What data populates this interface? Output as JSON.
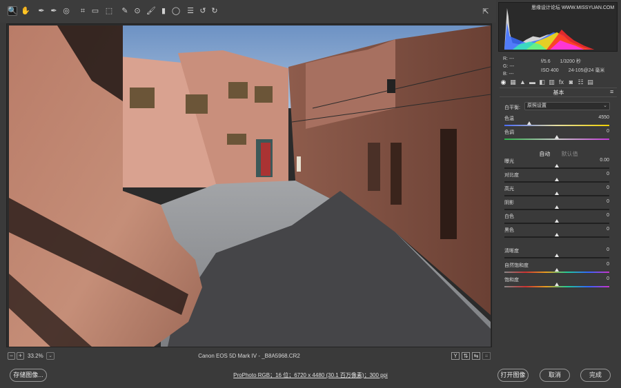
{
  "toolbar": {
    "tools": [
      {
        "name": "zoom-tool",
        "glyph": "🔍",
        "active": true
      },
      {
        "name": "hand-tool",
        "glyph": "✋"
      },
      {
        "name": "white-balance-tool",
        "glyph": "✒"
      },
      {
        "name": "color-sampler-tool",
        "glyph": "✒"
      },
      {
        "name": "targeted-adjustment-tool",
        "glyph": "◎"
      },
      {
        "name": "crop-tool",
        "glyph": "⌗"
      },
      {
        "name": "straighten-tool",
        "glyph": "▭"
      },
      {
        "name": "transform-tool",
        "glyph": "⬚"
      },
      {
        "name": "spot-removal-tool",
        "glyph": "✎"
      },
      {
        "name": "red-eye-tool",
        "glyph": "⊙"
      },
      {
        "name": "adjustment-brush-tool",
        "glyph": "🖌"
      },
      {
        "name": "graduated-filter-tool",
        "glyph": "▮"
      },
      {
        "name": "radial-filter-tool",
        "glyph": "◯"
      },
      {
        "name": "preferences-tool",
        "glyph": "☰"
      },
      {
        "name": "rotate-ccw-tool",
        "glyph": "↺"
      },
      {
        "name": "rotate-cw-tool",
        "glyph": "↻"
      }
    ],
    "fullscreen_glyph": "⇱"
  },
  "watermark": "思缘设计论坛 WWW.MISSYUAN.COM",
  "statusbar": {
    "zoom_out": "−",
    "zoom_in": "+",
    "zoom_level": "33.2%",
    "zoom_dropdown": "⌄",
    "file_info": "Canon EOS 5D Mark IV -  _B8A5968.CR2",
    "view_buttons": [
      "Y",
      "⇅",
      "⇆"
    ]
  },
  "bottom": {
    "save_label": "存储图像...",
    "workflow": "ProPhoto RGB；16 位；6720 x 4480 (30.1 百万像素)；300 ppi",
    "open_label": "打开图像",
    "cancel_label": "取消",
    "done_label": "完成"
  },
  "panel": {
    "rgb": {
      "r": "R:   ---",
      "g": "G:   ---",
      "b": "B:   ---"
    },
    "camera": {
      "aperture": "f/5.6",
      "shutter": "1/3200 秒",
      "iso": "ISO 400",
      "lens": "24-105@24 毫米"
    },
    "tabs": [
      "◉",
      "▦",
      "▲",
      "▬",
      "◧",
      "▥",
      "fx",
      "◙",
      "☷",
      "▤"
    ],
    "section_title": "基本",
    "section_menu": "≡",
    "wb_label": "白平衡:",
    "wb_value": "原照设置",
    "auto_label": "自动",
    "default_label": "默认值",
    "sliders": [
      {
        "key": "temperature",
        "label": "色温",
        "value": "4550",
        "pos": 0.24,
        "gradient": "linear-gradient(to right,#4a6cff,#e8e0a0,#f0d000)"
      },
      {
        "key": "tint",
        "label": "色调",
        "value": "0",
        "pos": 0.5,
        "gradient": "linear-gradient(to right,#2fb34a,#cccccc,#c43ad8)"
      },
      {
        "key": "exposure",
        "label": "曝光",
        "value": "0.00",
        "pos": 0.5
      },
      {
        "key": "contrast",
        "label": "对比度",
        "value": "0",
        "pos": 0.5
      },
      {
        "key": "highlights",
        "label": "高光",
        "value": "0",
        "pos": 0.5
      },
      {
        "key": "shadows",
        "label": "阴影",
        "value": "0",
        "pos": 0.5
      },
      {
        "key": "whites",
        "label": "白色",
        "value": "0",
        "pos": 0.5
      },
      {
        "key": "blacks",
        "label": "黑色",
        "value": "0",
        "pos": 0.5
      },
      {
        "key": "clarity",
        "label": "清晰度",
        "value": "0",
        "pos": 0.5
      },
      {
        "key": "vibrance",
        "label": "自然饱和度",
        "value": "0",
        "pos": 0.5,
        "gradient": "linear-gradient(to right,#888,#c33,#e8a020,#2c9,#36f,#c3c)"
      },
      {
        "key": "saturation",
        "label": "饱和度",
        "value": "0",
        "pos": 0.5,
        "gradient": "linear-gradient(to right,#888,#c33,#e8a020,#2c9,#36f,#c3c)"
      }
    ]
  }
}
